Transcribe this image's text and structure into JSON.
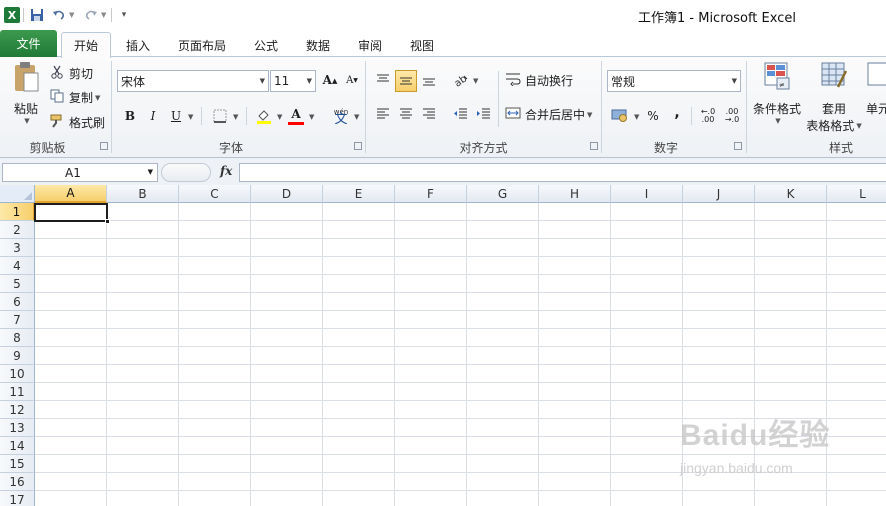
{
  "window": {
    "title": "工作簿1 - Microsoft Excel"
  },
  "quick_access": {
    "icons": [
      "excel-logo",
      "save-icon",
      "undo-icon",
      "redo-icon",
      "customize-icon"
    ]
  },
  "tabs": [
    {
      "label": "文件"
    },
    {
      "label": "开始"
    },
    {
      "label": "插入"
    },
    {
      "label": "页面布局"
    },
    {
      "label": "公式"
    },
    {
      "label": "数据"
    },
    {
      "label": "审阅"
    },
    {
      "label": "视图"
    }
  ],
  "ribbon": {
    "clipboard": {
      "group_label": "剪贴板",
      "paste": "粘贴",
      "cut": "剪切",
      "copy": "复制",
      "format_painter": "格式刷"
    },
    "font": {
      "group_label": "字体",
      "font_name": "宋体",
      "font_size": "11"
    },
    "alignment": {
      "group_label": "对齐方式",
      "wrap_text": "自动换行",
      "merge_center": "合并后居中"
    },
    "number": {
      "group_label": "数字",
      "format": "常规"
    },
    "styles": {
      "group_label": "样式",
      "conditional": "条件格式",
      "table_line1": "套用",
      "table_line2": "表格格式",
      "cell_styles": "单元"
    }
  },
  "formula_bar": {
    "name_box": "A1",
    "fx": "fx",
    "value": ""
  },
  "sheet": {
    "columns": [
      "A",
      "B",
      "C",
      "D",
      "E",
      "F",
      "G",
      "H",
      "I",
      "J",
      "K",
      "L"
    ],
    "rows": [
      "1",
      "2",
      "3",
      "4",
      "5",
      "6",
      "7",
      "8",
      "9",
      "10",
      "11",
      "12",
      "13",
      "14",
      "15",
      "16",
      "17"
    ],
    "selected_cell": "A1"
  },
  "watermark": {
    "logo": "Baidu经验",
    "url": "jingyan.baidu.com"
  },
  "colors": {
    "file_tab": "#1f7a36",
    "accent_selection": "#f7cf6b",
    "header_bg": "#e3e9f1"
  }
}
